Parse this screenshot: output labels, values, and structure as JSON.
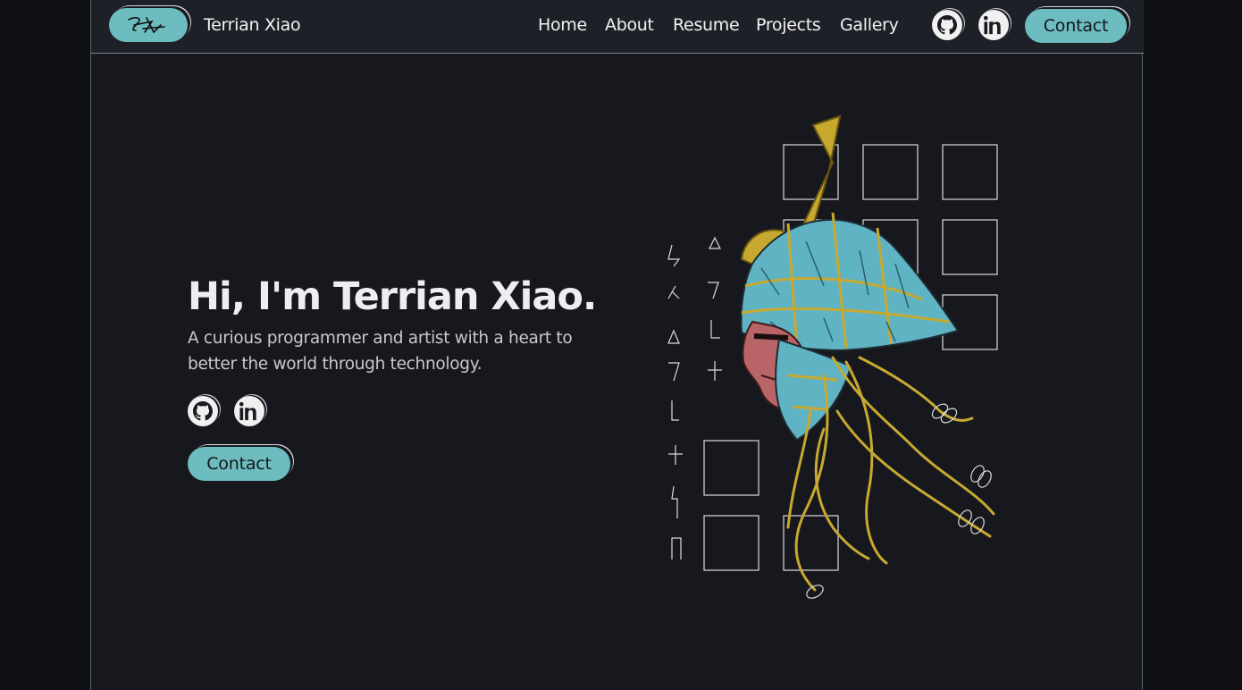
{
  "nav": {
    "brand": "Terrian Xiao",
    "links": [
      "Home",
      "About",
      "Resume",
      "Projects",
      "Gallery"
    ],
    "contact_label": "Contact"
  },
  "hero": {
    "title": "Hi, I'm Terrian Xiao.",
    "subtitle": "A curious programmer and artist with a heart to better the world through technology.",
    "contact_label": "Contact"
  },
  "colors": {
    "accent": "#6cbcc0",
    "background": "#17181d",
    "navbar": "#1e2028",
    "icon_bg": "#f0f0f0"
  },
  "icons": {
    "github": "github-icon",
    "linkedin": "linkedin-icon",
    "logo": "signature-logo"
  }
}
